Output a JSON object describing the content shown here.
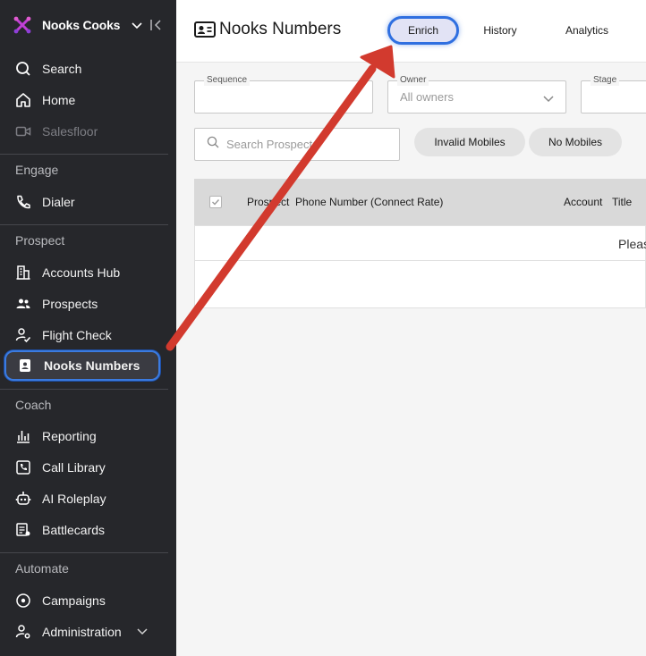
{
  "sidebar": {
    "brand": "Nooks Cooks",
    "items": {
      "search": "Search",
      "home": "Home",
      "salesfloor": "Salesfloor",
      "dialer": "Dialer",
      "accounts_hub": "Accounts Hub",
      "prospects": "Prospects",
      "flight_check": "Flight Check",
      "nooks_numbers": "Nooks Numbers",
      "reporting": "Reporting",
      "call_library": "Call Library",
      "ai_roleplay": "AI Roleplay",
      "battlecards": "Battlecards",
      "campaigns": "Campaigns",
      "administration": "Administration"
    },
    "sections": {
      "engage": "Engage",
      "prospect": "Prospect",
      "coach": "Coach",
      "automate": "Automate"
    }
  },
  "header": {
    "title": "Nooks Numbers",
    "tabs": {
      "enrich": "Enrich",
      "history": "History",
      "analytics": "Analytics"
    }
  },
  "filters": {
    "sequence": {
      "label": "Sequence",
      "value": ""
    },
    "owner": {
      "label": "Owner",
      "value": "All owners"
    },
    "stage": {
      "label": "Stage",
      "value": ""
    }
  },
  "search": {
    "placeholder": "Search Prospects"
  },
  "chips": {
    "invalid_mobiles": "Invalid Mobiles",
    "no_mobiles": "No Mobiles"
  },
  "table": {
    "columns": {
      "prospect": "Prospect",
      "phone": "Phone Number (Connect Rate)",
      "account": "Account",
      "title": "Title"
    },
    "empty_message": "Please"
  },
  "colors": {
    "sidebar_bg": "#26272b",
    "accent": "#2f6fe0",
    "arrow": "#d23a2e"
  }
}
